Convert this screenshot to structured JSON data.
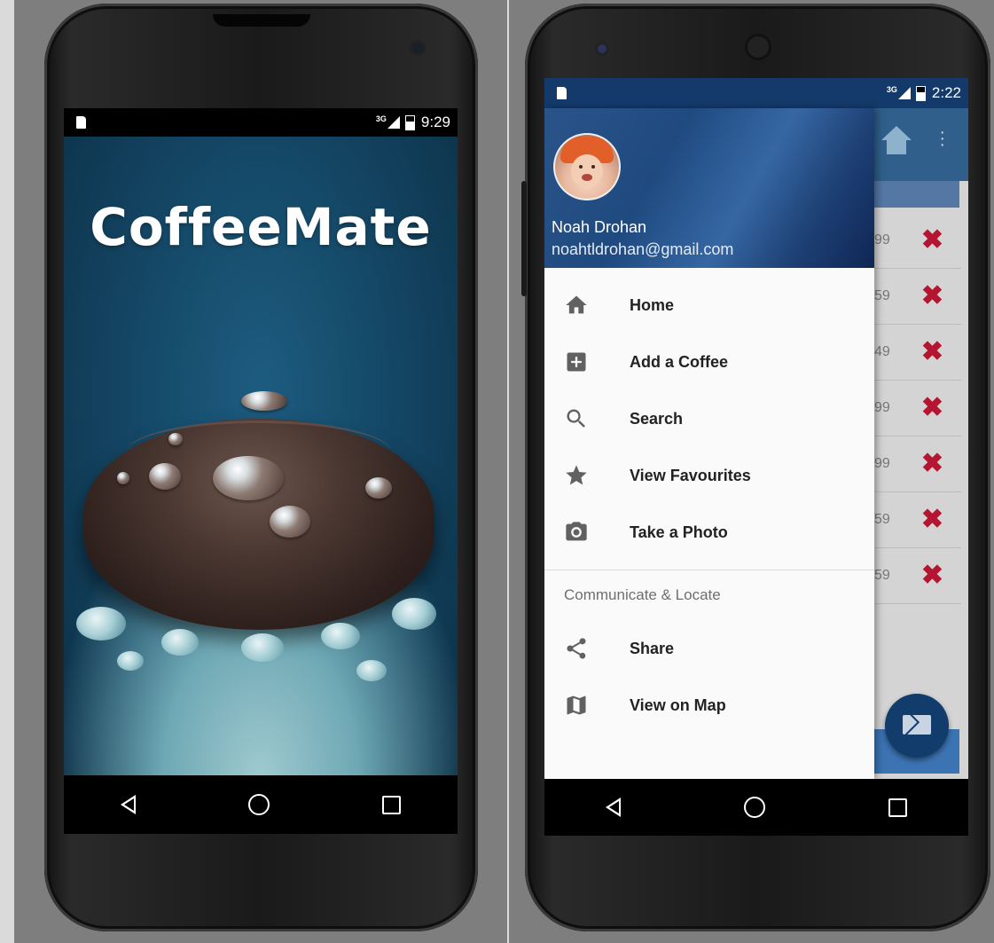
{
  "left_phone": {
    "status_bar": {
      "network": "3G",
      "time": "9:29"
    },
    "splash": {
      "title": "CoffeeMate"
    }
  },
  "right_phone": {
    "status_bar": {
      "network": "3G",
      "time": "2:22"
    },
    "drawer": {
      "user": {
        "name": "Noah Drohan",
        "email": "noahtldrohan@gmail.com"
      },
      "items": [
        {
          "label": "Home",
          "icon": "home-icon"
        },
        {
          "label": "Add a Coffee",
          "icon": "add-box-icon"
        },
        {
          "label": "Search",
          "icon": "search-icon"
        },
        {
          "label": "View Favourites",
          "icon": "star-icon"
        },
        {
          "label": "Take a Photo",
          "icon": "camera-icon"
        }
      ],
      "section_title": "Communicate & Locate",
      "section_items": [
        {
          "label": "Share",
          "icon": "share-icon"
        },
        {
          "label": "View on Map",
          "icon": "map-icon"
        }
      ]
    },
    "background_list": {
      "visible_prices": [
        "99",
        "59",
        "49",
        "99",
        "99",
        "59",
        "59"
      ]
    }
  }
}
